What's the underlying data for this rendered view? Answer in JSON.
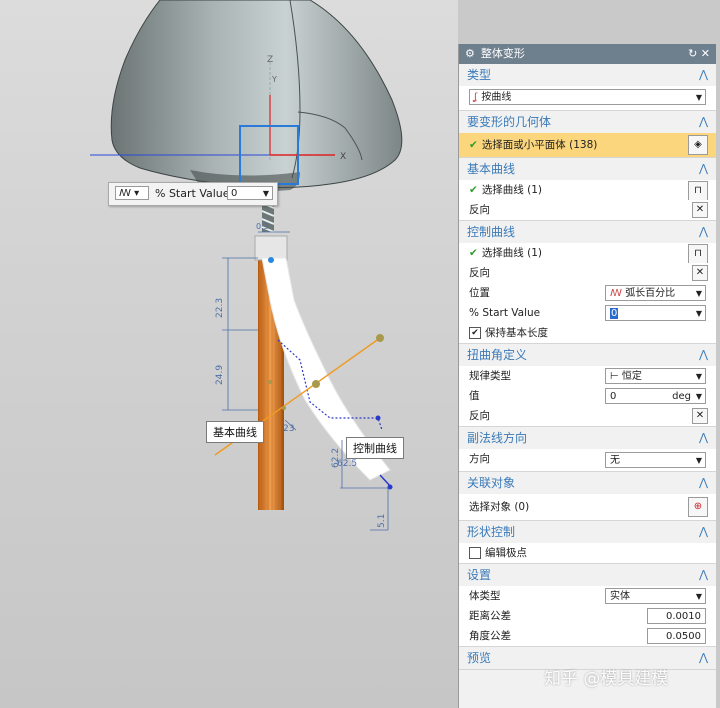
{
  "viewport": {
    "axis_z": "Z",
    "axis_y": "Y",
    "axis_x": "X",
    "float_bar": {
      "icon_text": "ꟿ ▾",
      "label": "% Start Value",
      "value": "0"
    },
    "dims": {
      "d1": "0.3",
      "d2": "22.3",
      "d3": "24.9",
      "d4": "23",
      "d5": "62.2",
      "d6": "62.5",
      "d7": "5.1"
    },
    "tag_base_curve": "基本曲线",
    "tag_control_curve": "控制曲线"
  },
  "panel": {
    "title": "整体变形",
    "title_btns": "↻ ✕",
    "sections": {
      "type": {
        "title": "类型",
        "select": "按曲线"
      },
      "geom": {
        "title": "要变形的几何体",
        "row": "选择面或小平面体 (138)"
      },
      "base_curve": {
        "title": "基本曲线",
        "select": "选择曲线 (1)",
        "reverse": "反向"
      },
      "ctrl_curve": {
        "title": "控制曲线",
        "select": "选择曲线 (1)",
        "reverse": "反向",
        "pos_label": "位置",
        "pos_value": "弧长百分比",
        "start_label": "% Start Value",
        "start_value": "0",
        "keep_len": "保持基本长度"
      },
      "twist": {
        "title": "扭曲角定义",
        "law_label": "规律类型",
        "law_value": "恒定",
        "val_label": "值",
        "val_value": "0",
        "val_unit": "deg",
        "reverse": "反向"
      },
      "binormal": {
        "title": "副法线方向",
        "dir_label": "方向",
        "dir_value": "无"
      },
      "assoc": {
        "title": "关联对象",
        "select": "选择对象 (0)"
      },
      "shape": {
        "title": "形状控制",
        "edit_poles": "编辑极点"
      },
      "settings": {
        "title": "设置",
        "body_label": "体类型",
        "body_value": "实体",
        "dist_label": "距离公差",
        "dist_value": "0.0010",
        "ang_label": "角度公差",
        "ang_value": "0.0500"
      },
      "preview": {
        "title": "预览"
      }
    }
  },
  "watermark": "知乎 @模具建模"
}
